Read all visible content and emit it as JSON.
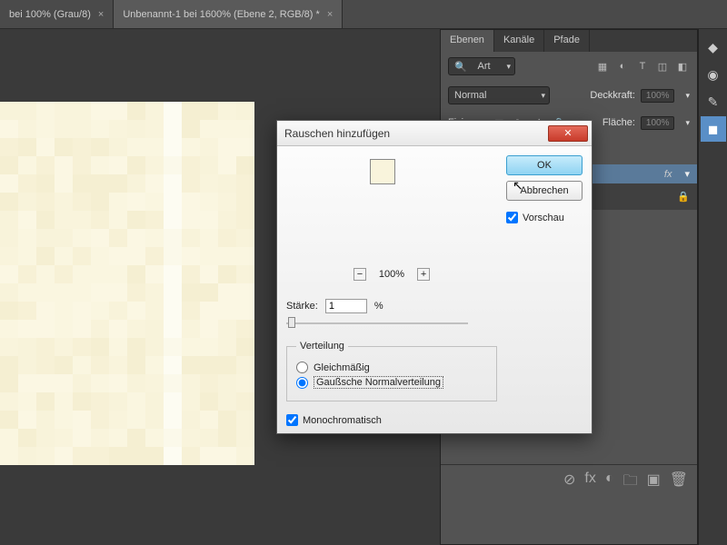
{
  "tabs": [
    {
      "label": "bei 100% (Grau/8)"
    },
    {
      "label": "Unbenannt-1 bei 1600% (Ebene 2, RGB/8) *"
    }
  ],
  "panel": {
    "tabs": [
      "Ebenen",
      "Kanäle",
      "Pfade"
    ],
    "filter_label": "Art",
    "blend_mode": "Normal",
    "opacity_label": "Deckkraft:",
    "opacity_value": "100%",
    "lock_label": "Fixieren:",
    "fill_label": "Fläche:",
    "fill_value": "100%",
    "layer_fx": "fx"
  },
  "dialog": {
    "title": "Rauschen hinzufügen",
    "ok": "OK",
    "cancel": "Abbrechen",
    "preview": "Vorschau",
    "zoom": "100%",
    "strength_label": "Stärke:",
    "strength_value": "1",
    "strength_unit": "%",
    "distribution": "Verteilung",
    "uniform": "Gleichmäßig",
    "gaussian": "Gaußsche Normalverteilung",
    "mono": "Monochromatisch"
  },
  "colors": {
    "canvas_base": "#f9f4dc",
    "accent": "#5a8fc7"
  }
}
